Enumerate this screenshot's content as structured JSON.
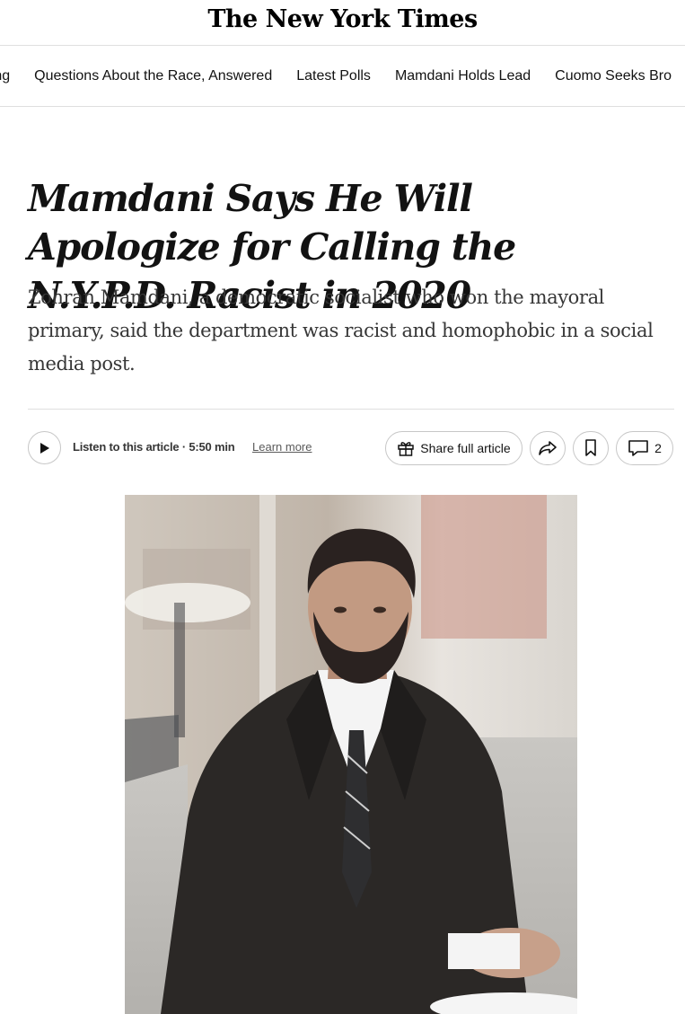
{
  "masthead": {
    "logo_text": "The New York Times"
  },
  "nav": {
    "items": [
      "nning",
      "Questions About the Race, Answered",
      "Latest Polls",
      "Mamdani Holds Lead",
      "Cuomo Seeks Bro"
    ]
  },
  "article": {
    "headline": "Mamdani Says He Will Apologize for Calling the N.Y.P.D. Racist in 2020",
    "summary": "Zohran Mamdani, a democratic socialist who won the mayoral primary, said the department was racist and homophobic in a social media post."
  },
  "toolbar": {
    "listen_text": "Listen to this article · 5:50 min",
    "learn_more": "Learn more",
    "share_full_label": "Share full article",
    "comments_count": "2"
  },
  "icons": {
    "play": "play-icon",
    "gift": "gift-icon",
    "share": "share-arrow-icon",
    "bookmark": "bookmark-icon",
    "comment": "comment-icon"
  }
}
